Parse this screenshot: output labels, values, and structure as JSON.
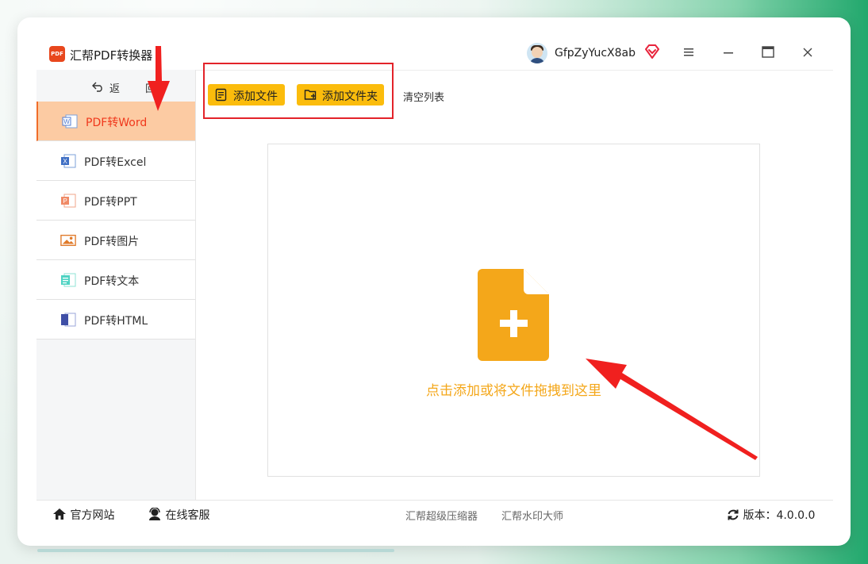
{
  "app": {
    "title": "汇帮PDF转换器",
    "logo_text": "PDF"
  },
  "user": {
    "name": "GfpZyYucX8ab"
  },
  "window_controls": [
    "menu-icon",
    "minimize-icon",
    "maximize-icon",
    "close-icon"
  ],
  "sidebar": {
    "back_label": "返 回",
    "items": [
      {
        "label": "PDF转Word",
        "icon": "word-icon",
        "active": true
      },
      {
        "label": "PDF转Excel",
        "icon": "excel-icon",
        "active": false
      },
      {
        "label": "PDF转PPT",
        "icon": "ppt-icon",
        "active": false
      },
      {
        "label": "PDF转图片",
        "icon": "image-icon",
        "active": false
      },
      {
        "label": "PDF转文本",
        "icon": "text-icon",
        "active": false
      },
      {
        "label": "PDF转HTML",
        "icon": "html-icon",
        "active": false
      }
    ]
  },
  "toolbar": {
    "add_file": "添加文件",
    "add_folder": "添加文件夹",
    "clear_list": "清空列表"
  },
  "dropzone": {
    "label": "点击添加或将文件拖拽到这里"
  },
  "footer": {
    "website": "官方网站",
    "service": "在线客服",
    "compressor": "汇帮超级压缩器",
    "watermark": "汇帮水印大师",
    "version_label": "版本：4.0.0.0"
  },
  "colors": {
    "accent_orange": "#fbbc0c",
    "active_bg": "#fccba3",
    "active_text": "#f0381c",
    "drop_orange": "#f4a71a",
    "annotation_red": "#e3232a"
  }
}
